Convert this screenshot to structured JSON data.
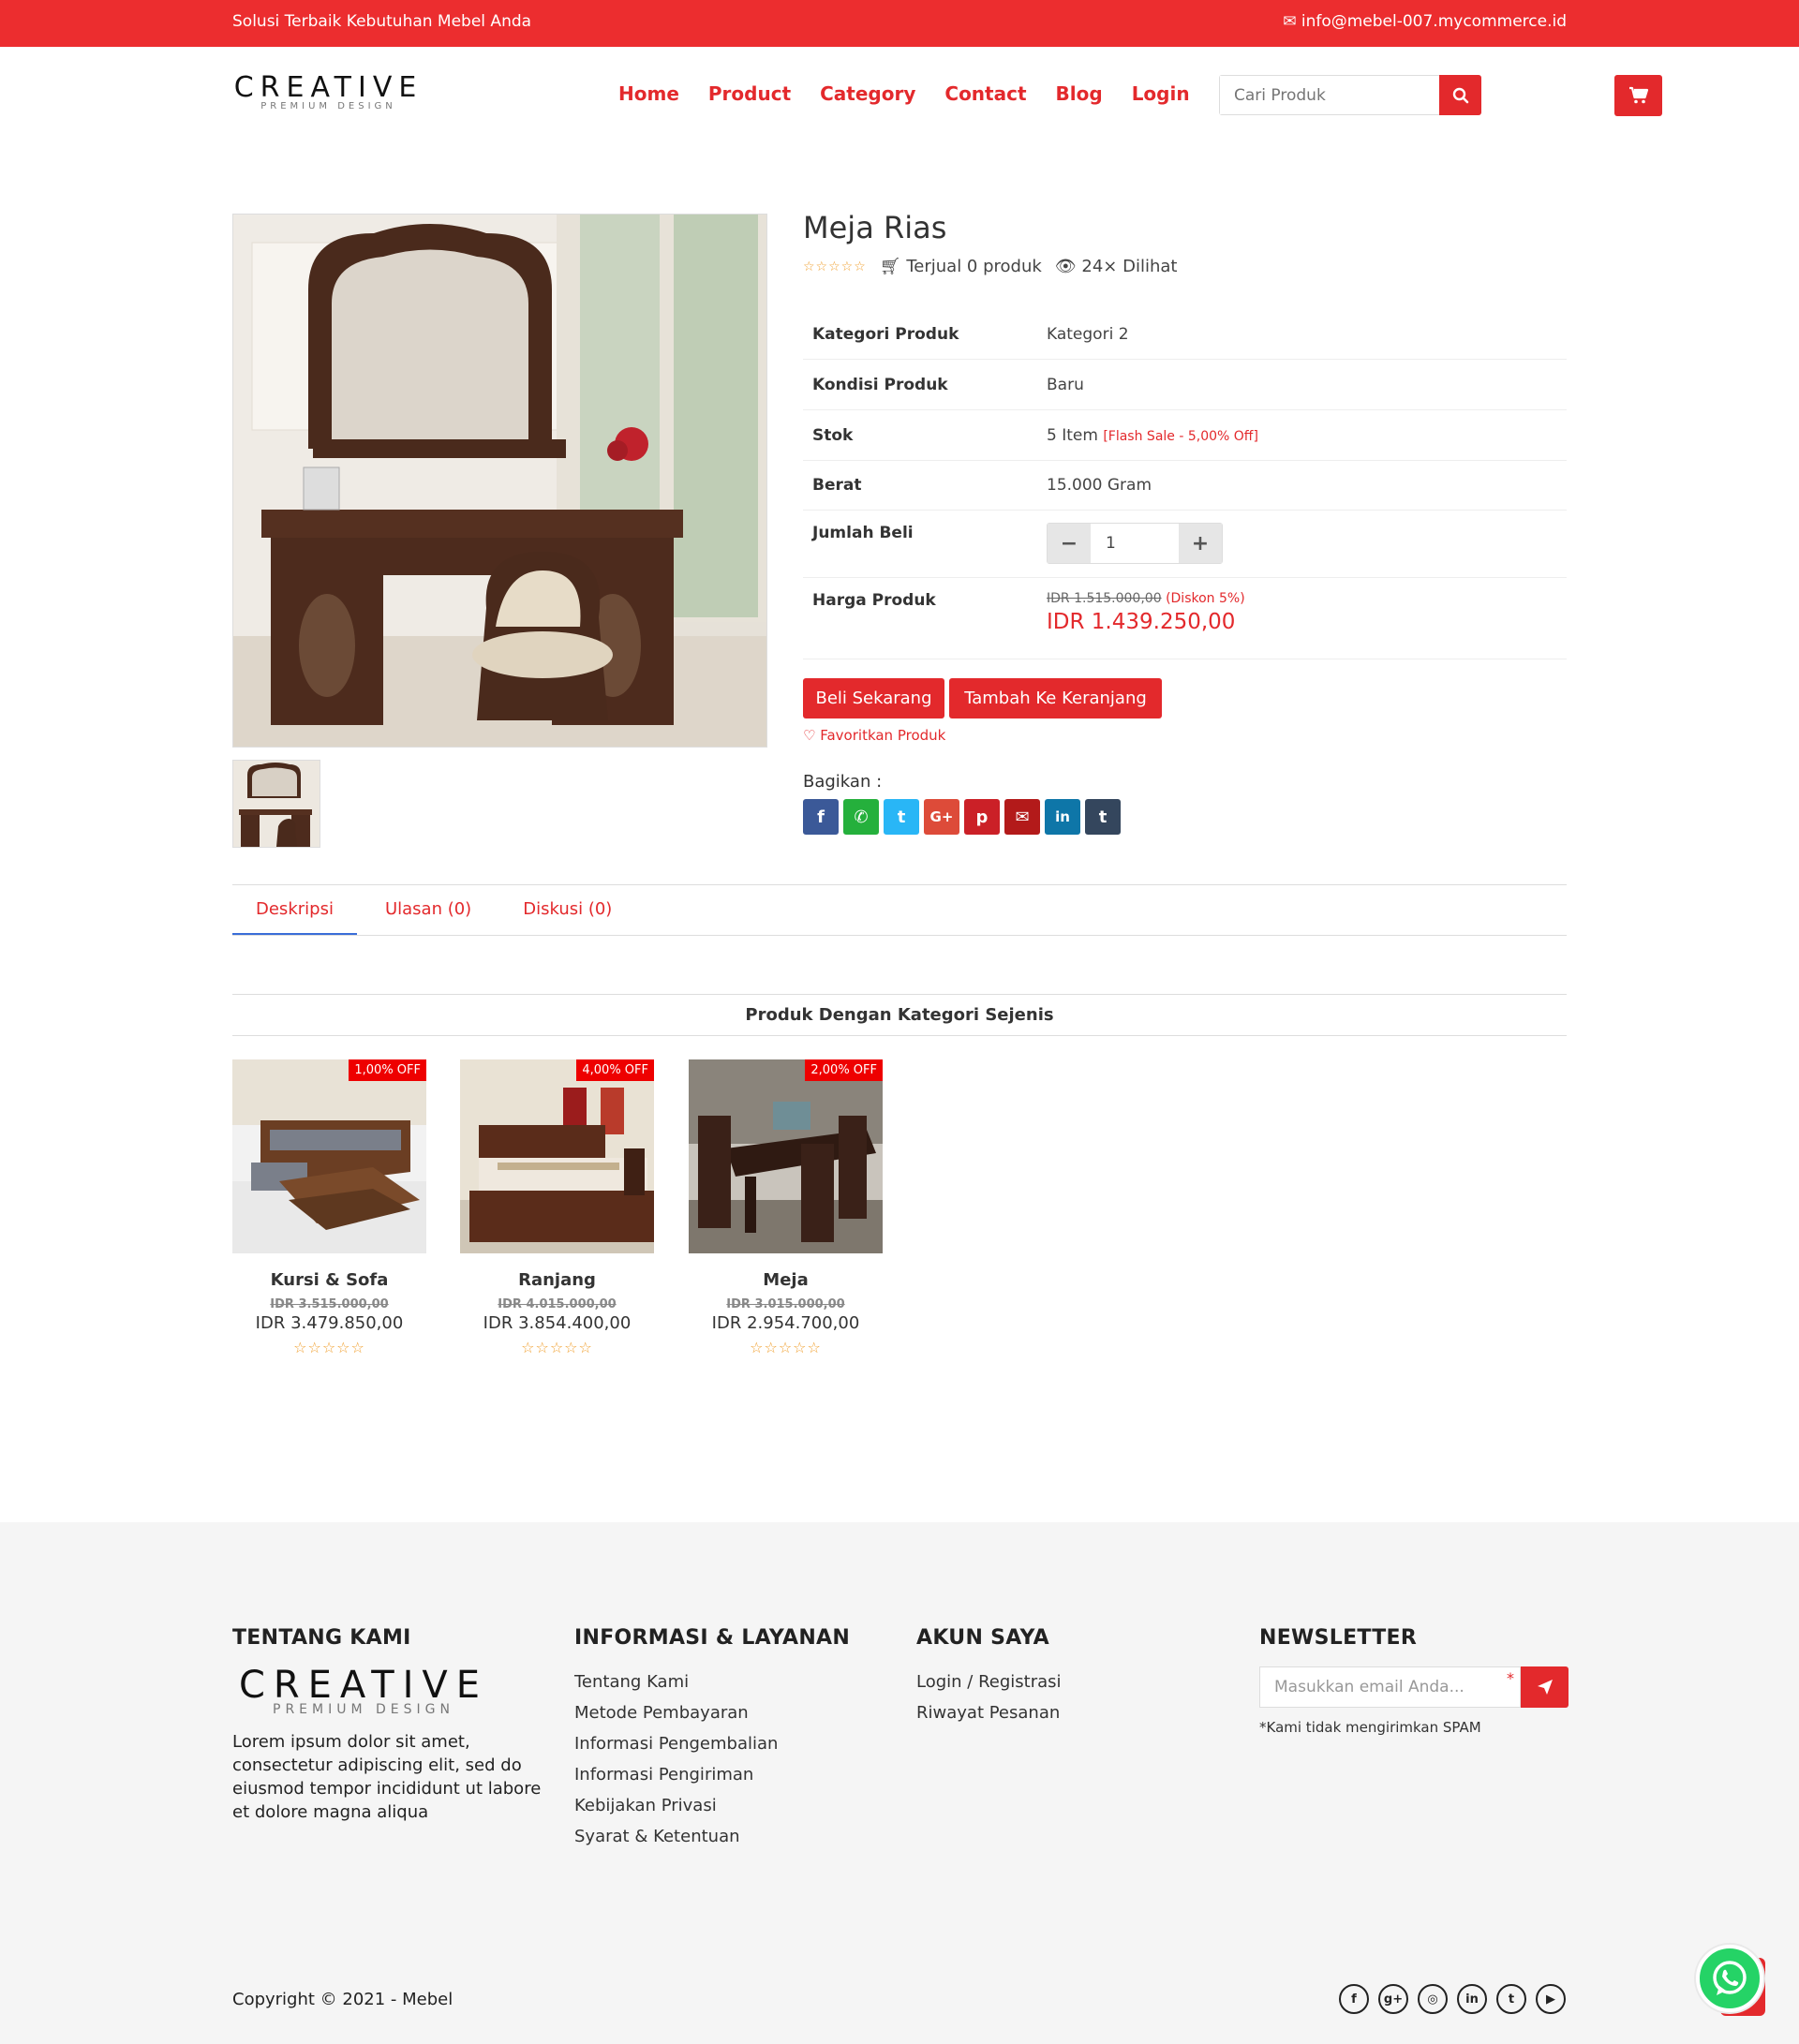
{
  "topbar": {
    "tagline": "Solusi Terbaik Kebutuhan Mebel Anda",
    "email": "info@mebel-007.mycommerce.id"
  },
  "brand": {
    "name": "CREATIVE",
    "sub": "PREMIUM DESIGN"
  },
  "nav": [
    "Home",
    "Product",
    "Category",
    "Contact",
    "Blog",
    "Login"
  ],
  "search": {
    "placeholder": "Cari Produk"
  },
  "product": {
    "title": "Meja Rias",
    "rating": 0,
    "sold": "Terjual 0 produk",
    "views": "24× Dilihat",
    "specs": [
      {
        "key": "Kategori Produk",
        "value": "Kategori 2"
      },
      {
        "key": "Kondisi Produk",
        "value": "Baru"
      },
      {
        "key": "Stok",
        "value": "5 Item",
        "note": "[Flash Sale - 5,00% Off]"
      },
      {
        "key": "Berat",
        "value": "15.000 Gram"
      },
      {
        "key": "Jumlah Beli",
        "value": "1"
      },
      {
        "key": "Harga Produk",
        "old_price": "IDR 1.515.000,00",
        "discount": "(Diskon 5%)",
        "price": "IDR 1.439.250,00"
      }
    ],
    "buy_now": "Beli Sekarang",
    "add_to_cart": "Tambah Ke Keranjang",
    "favorite": "Favoritkan Produk",
    "share_label": "Bagikan :",
    "share_icons": [
      {
        "name": "facebook-icon",
        "glyph": "f",
        "color": "#3b5998"
      },
      {
        "name": "whatsapp-icon",
        "glyph": "✆",
        "color": "#25b03c"
      },
      {
        "name": "twitter-icon",
        "glyph": "t",
        "color": "#29b6f6"
      },
      {
        "name": "google-plus-icon",
        "glyph": "G+",
        "color": "#dd4b39"
      },
      {
        "name": "pinterest-icon",
        "glyph": "p",
        "color": "#cb2027"
      },
      {
        "name": "email-icon",
        "glyph": "✉",
        "color": "#b31a1a"
      },
      {
        "name": "linkedin-icon",
        "glyph": "in",
        "color": "#0e76a8"
      },
      {
        "name": "tumblr-icon",
        "glyph": "t",
        "color": "#34465d"
      }
    ]
  },
  "tabs": [
    "Deskripsi",
    "Ulasan (0)",
    "Diskusi (0)"
  ],
  "related": {
    "title": "Produk Dengan Kategori Sejenis",
    "items": [
      {
        "name": "Kursi & Sofa",
        "badge": "1,00% OFF",
        "old_price": "IDR 3.515.000,00",
        "price": "IDR 3.479.850,00",
        "rating": 0
      },
      {
        "name": "Ranjang",
        "badge": "4,00% OFF",
        "old_price": "IDR 4.015.000,00",
        "price": "IDR 3.854.400,00",
        "rating": 0
      },
      {
        "name": "Meja",
        "badge": "2,00% OFF",
        "old_price": "IDR 3.015.000,00",
        "price": "IDR 2.954.700,00",
        "rating": 0
      }
    ]
  },
  "footer": {
    "about": {
      "title": "TENTANG KAMI",
      "text": "Lorem ipsum dolor sit amet, consectetur adipiscing elit, sed do eiusmod tempor incididunt ut labore et dolore magna aliqua"
    },
    "info": {
      "title": "INFORMASI & LAYANAN",
      "links": [
        "Tentang Kami",
        "Metode Pembayaran",
        "Informasi Pengembalian",
        "Informasi Pengiriman",
        "Kebijakan Privasi",
        "Syarat & Ketentuan"
      ]
    },
    "account": {
      "title": "AKUN SAYA",
      "links": [
        "Login / Registrasi",
        "Riwayat Pesanan"
      ]
    },
    "newsletter": {
      "title": "NEWSLETTER",
      "placeholder": "Masukkan email Anda...",
      "note": "*Kami tidak mengirimkan SPAM"
    },
    "copyright": "Copyright © 2021 - Mebel",
    "social": [
      {
        "name": "facebook-icon",
        "glyph": "f"
      },
      {
        "name": "google-plus-icon",
        "glyph": "g+"
      },
      {
        "name": "instagram-icon",
        "glyph": "◎"
      },
      {
        "name": "linkedin-icon",
        "glyph": "in"
      },
      {
        "name": "twitter-icon",
        "glyph": "t"
      },
      {
        "name": "youtube-icon",
        "glyph": "▶"
      }
    ]
  }
}
